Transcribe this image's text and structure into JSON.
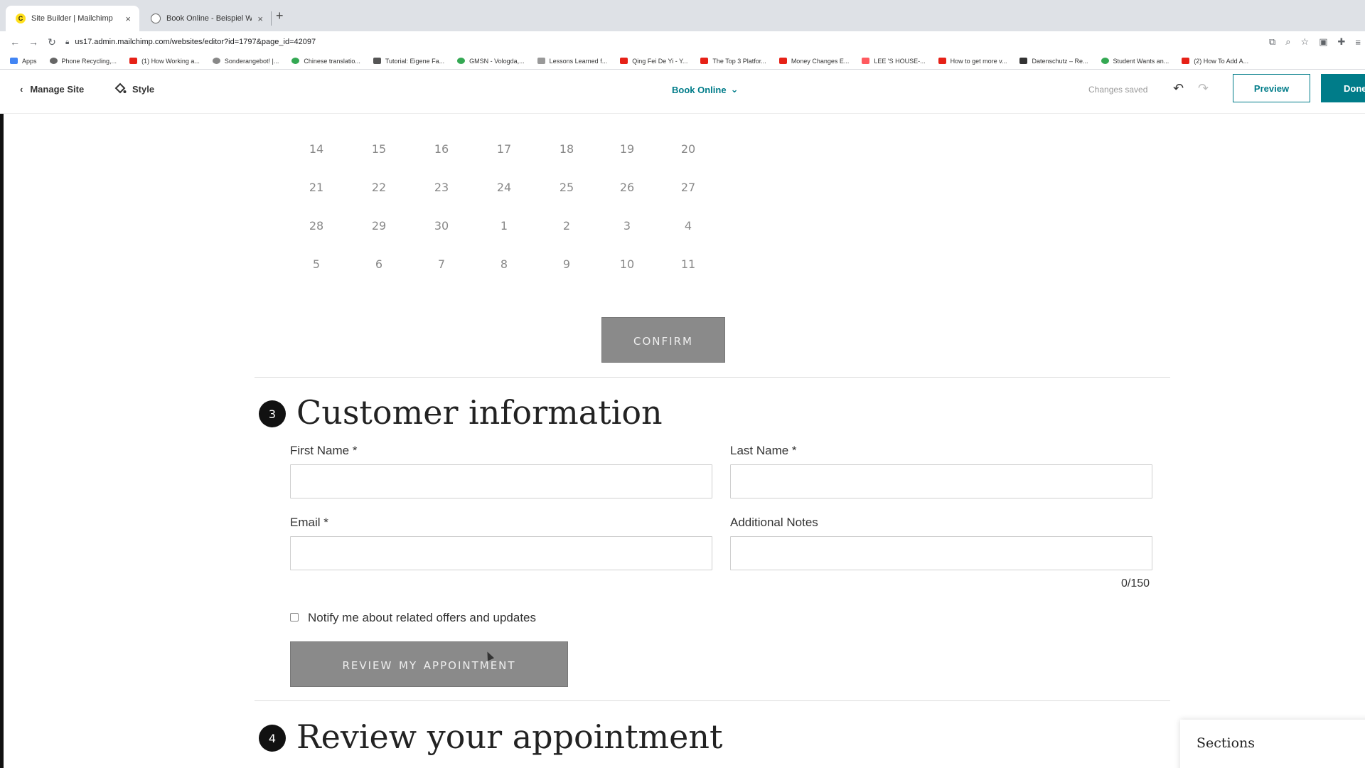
{
  "browser": {
    "tabs": [
      {
        "title": "Site Builder | Mailchimp",
        "favicon": "mailchimp-icon",
        "active": true
      },
      {
        "title": "Book Online - Beispiel Websei",
        "favicon": "globe-icon",
        "active": false
      }
    ],
    "url": "us17.admin.mailchimp.com/websites/editor?id=1797&page_id=42097",
    "bookmarks": [
      "Apps",
      "Phone Recycling,...",
      "(1) How Working a...",
      "Sonderangebot! |...",
      "Chinese translatio...",
      "Tutorial: Eigene Fa...",
      "GMSN - Vologda,...",
      "Lessons Learned f...",
      "Qing Fei De Yi - Y...",
      "The Top 3 Platfor...",
      "Money Changes E...",
      "LEE 'S HOUSE-...",
      "How to get more v...",
      "Datenschutz – Re...",
      "Student Wants an...",
      "(2) How To Add A..."
    ]
  },
  "editor": {
    "manage_site": "Manage Site",
    "style": "Style",
    "page": "Book Online",
    "status": "Changes saved",
    "preview": "Preview",
    "done": "Done"
  },
  "calendar": {
    "rows": [
      [
        "14",
        "15",
        "16",
        "17",
        "18",
        "19",
        "20"
      ],
      [
        "21",
        "22",
        "23",
        "24",
        "25",
        "26",
        "27"
      ],
      [
        "28",
        "29",
        "30",
        "1",
        "2",
        "3",
        "4"
      ],
      [
        "5",
        "6",
        "7",
        "8",
        "9",
        "10",
        "11"
      ]
    ],
    "confirm": "confirm"
  },
  "customer": {
    "step": "3",
    "title": "Customer information",
    "first_name_label": "First Name *",
    "last_name_label": "Last Name *",
    "email_label": "Email *",
    "notes_label": "Additional Notes",
    "first_name_value": "",
    "last_name_value": "",
    "email_value": "",
    "notes_value": "",
    "char_count": "0/150",
    "notify_label": "Notify me about related offers and updates",
    "review_button": "review my appointment"
  },
  "review": {
    "step": "4",
    "title": "Review your appointment"
  },
  "sections_panel": {
    "label": "Sections"
  },
  "colors": {
    "brand_teal": "#007c89",
    "button_gray": "#8a8a8a"
  }
}
